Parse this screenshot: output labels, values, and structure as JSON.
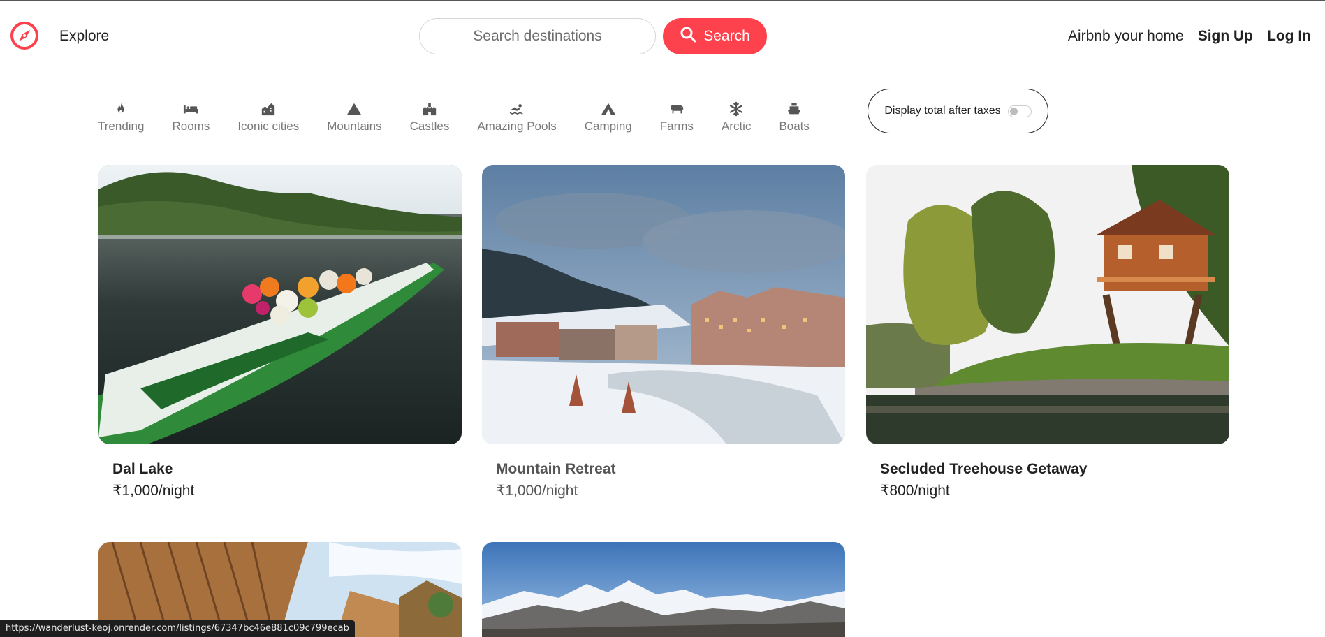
{
  "nav": {
    "explore": "Explore",
    "search_placeholder": "Search destinations",
    "search_button": "Search",
    "host_link": "Airbnb your home",
    "signup": "Sign Up",
    "login": "Log In",
    "brand_color": "#fe424d"
  },
  "filters": [
    {
      "label": "Trending",
      "icon": "fire-icon"
    },
    {
      "label": "Rooms",
      "icon": "bed-icon"
    },
    {
      "label": "Iconic cities",
      "icon": "city-icon"
    },
    {
      "label": "Mountains",
      "icon": "mountain-icon"
    },
    {
      "label": "Castles",
      "icon": "castle-icon"
    },
    {
      "label": "Amazing Pools",
      "icon": "swimmer-icon"
    },
    {
      "label": "Camping",
      "icon": "tent-icon"
    },
    {
      "label": "Farms",
      "icon": "cow-icon"
    },
    {
      "label": "Arctic",
      "icon": "snowflake-icon"
    },
    {
      "label": "Boats",
      "icon": "ship-icon"
    }
  ],
  "tax_toggle": {
    "label": "Display total after taxes",
    "enabled": false
  },
  "listings": [
    {
      "title": "Dal Lake",
      "price": "₹1,000/night"
    },
    {
      "title": "Mountain Retreat",
      "price": "₹1,000/night"
    },
    {
      "title": "Secluded Treehouse Getaway",
      "price": "₹800/night"
    },
    {
      "title": "",
      "price": ""
    },
    {
      "title": "",
      "price": ""
    }
  ],
  "status_url": "https://wanderlust-keoj.onrender.com/listings/67347bc46e881c09c799ecab"
}
